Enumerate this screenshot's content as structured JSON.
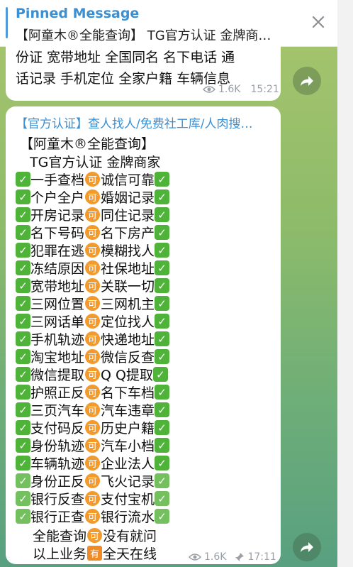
{
  "pinned": {
    "title": "Pinned Message",
    "text": "【阿童木®全能查询】 TG官方认证 金牌商…"
  },
  "message1": {
    "line1": "份证 宽带地址 全国同名 名下电话 通",
    "line2": "话记录 手机定位 全家户籍 车辆信息",
    "views": "1.6K",
    "time": "15:21"
  },
  "message2": {
    "link": "【官方认证】查人找人/免费社工库/人肉搜…",
    "head1": "【阿童木®全能查询】",
    "head2": "TG官方认证 金牌商家",
    "pill_char": "可",
    "rows": [
      {
        "left": "一手查档",
        "right": "诚信可靠"
      },
      {
        "left": "个户全户",
        "right": "婚姻记录"
      },
      {
        "left": "开房记录",
        "right": "同住记录"
      },
      {
        "left": "名下号码",
        "right": "名下房产"
      },
      {
        "left": "犯罪在逃",
        "right": "模糊找人"
      },
      {
        "left": "冻结原因",
        "right": "社保地址"
      },
      {
        "left": "宽带地址",
        "right": "关联一切"
      },
      {
        "left": "三网位置",
        "right": "三网机主"
      },
      {
        "left": "三网话单",
        "right": "定位找人"
      },
      {
        "left": "手机轨迹",
        "right": "快递地址"
      },
      {
        "left": "淘宝地址",
        "right": "微信反查"
      },
      {
        "left": "微信提取",
        "right": "Q Q提取"
      },
      {
        "left": "护照正反",
        "right": "名下车档"
      },
      {
        "left": "三页汽车",
        "right": "汽车违章"
      },
      {
        "left": "支付码反",
        "right": "历史户籍"
      },
      {
        "left": "身份轨迹",
        "right": "汽车小档"
      },
      {
        "left": "车辆轨迹",
        "right": "企业法人"
      },
      {
        "left": "身份正反",
        "right": "飞火记录"
      },
      {
        "left": "银行反查",
        "right": "支付宝机"
      },
      {
        "left": "银行正查",
        "right": "银行流水"
      }
    ],
    "footer1": {
      "left": "全能查询",
      "pill": "可",
      "right": "没有就问"
    },
    "footer2": {
      "left": "以上业务",
      "pill": "有",
      "right": "全天在线"
    },
    "views": "1.6K",
    "time": "17:11"
  }
}
